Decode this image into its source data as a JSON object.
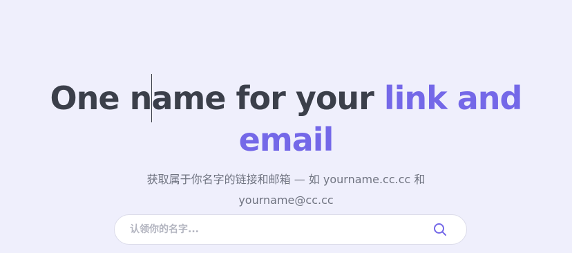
{
  "hero": {
    "headline_part1": "One name for your ",
    "headline_accent": "link and email",
    "subtitle": "获取属于你名字的链接和邮箱 — 如 yourname.cc.cc 和 yourname@cc.cc"
  },
  "search": {
    "placeholder": "认领你的名字...",
    "value": "",
    "icon": "search-icon"
  },
  "colors": {
    "background": "#efeffc",
    "text": "#3b3f4a",
    "accent": "#7468e8",
    "muted": "#6f7380"
  }
}
